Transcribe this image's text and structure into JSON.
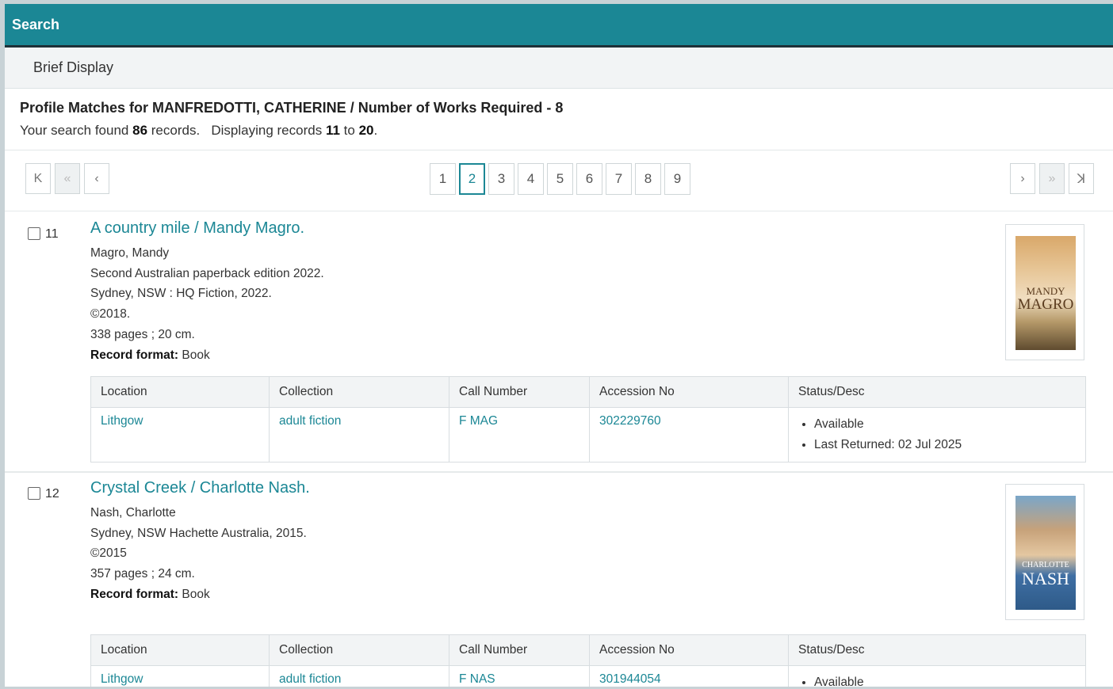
{
  "header": {
    "title": "Search"
  },
  "subheader": {
    "label": "Brief Display"
  },
  "profile": {
    "heading": "Profile Matches for MANFREDOTTI, CATHERINE / Number of Works Required - 8",
    "found_prefix": "Your search found",
    "found_count": "86",
    "found_suffix": "records.",
    "display_prefix": "Displaying records",
    "display_from": "11",
    "display_to_word": "to",
    "display_to": "20",
    "display_end": "."
  },
  "pagination": {
    "first": "K",
    "prev_group": "«",
    "prev": "‹",
    "next": "›",
    "next_group": "»",
    "last": "ꓘ",
    "pages": [
      "1",
      "2",
      "3",
      "4",
      "5",
      "6",
      "7",
      "8",
      "9"
    ],
    "current": "2"
  },
  "holdings_headers": [
    "Location",
    "Collection",
    "Call Number",
    "Accession No",
    "Status/Desc"
  ],
  "records": [
    {
      "number": "11",
      "title": "A country mile / Mandy Magro.",
      "lines": [
        "Magro, Mandy",
        "Second Australian paperback edition 2022.",
        "Sydney, NSW : HQ Fiction, 2022.",
        "©2018.",
        "338 pages ; 20 cm."
      ],
      "format_label": "Record format:",
      "format_value": "Book",
      "cover_text_top": "MANDY",
      "cover_text_bottom": "MAGRO",
      "holding": {
        "location": "Lithgow",
        "collection": "adult fiction",
        "call_number": "F MAG",
        "accession": "302229760",
        "status": [
          "Available",
          "Last Returned: 02 Jul 2025"
        ]
      }
    },
    {
      "number": "12",
      "title": "Crystal Creek / Charlotte Nash.",
      "lines": [
        "Nash, Charlotte",
        "Sydney, NSW Hachette Australia, 2015.",
        "©2015",
        "357 pages ; 24 cm."
      ],
      "format_label": "Record format:",
      "format_value": "Book",
      "cover_text_top": "CHARLOTTE",
      "cover_text_bottom": "NASH",
      "holding": {
        "location": "Lithgow",
        "collection": "adult fiction",
        "call_number": "F NAS",
        "accession": "301944054",
        "status": [
          "Available"
        ]
      }
    }
  ]
}
